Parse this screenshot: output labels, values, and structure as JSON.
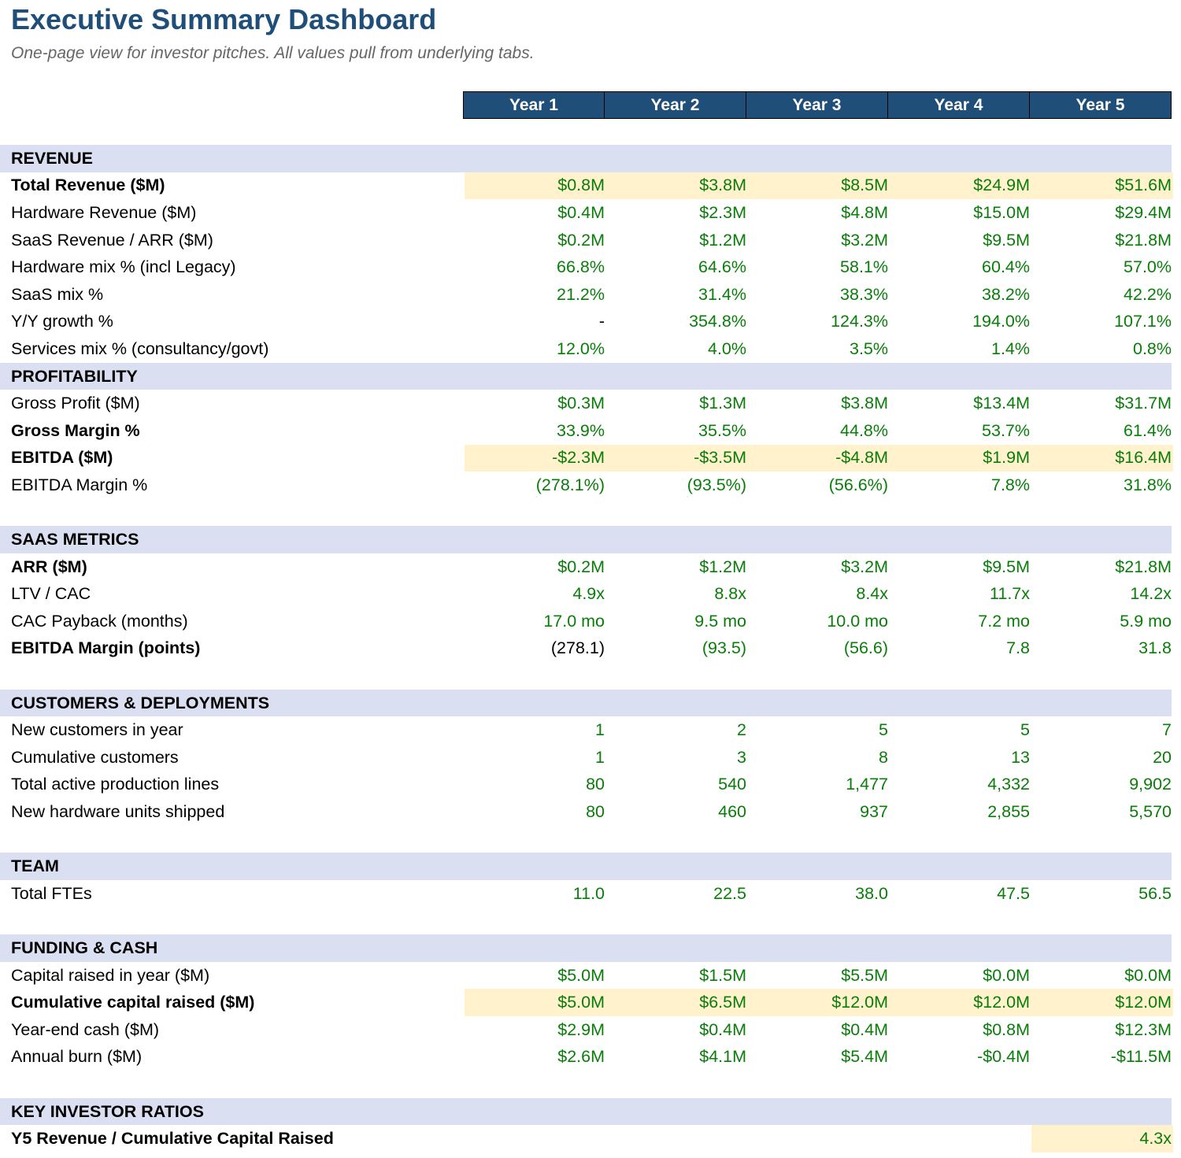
{
  "title": "Executive Summary Dashboard",
  "subtitle": "One-page view for investor pitches. All values pull from underlying tabs.",
  "years": [
    "Year 1",
    "Year 2",
    "Year 3",
    "Year 4",
    "Year 5"
  ],
  "colors": {
    "header_bg": "#1f4e79",
    "section_bg": "#dae0f2",
    "highlight_bg": "#fff2cc",
    "value_green": "#0a7d0a"
  },
  "rows": [
    {
      "type": "section",
      "label": "REVENUE"
    },
    {
      "type": "data",
      "label": "Total Revenue ($M)",
      "bold": true,
      "highlight": true,
      "values": [
        "$0.8M",
        "$3.8M",
        "$8.5M",
        "$24.9M",
        "$51.6M"
      ]
    },
    {
      "type": "data",
      "label": "Hardware Revenue ($M)",
      "values": [
        "$0.4M",
        "$2.3M",
        "$4.8M",
        "$15.0M",
        "$29.4M"
      ]
    },
    {
      "type": "data",
      "label": "SaaS Revenue / ARR ($M)",
      "values": [
        "$0.2M",
        "$1.2M",
        "$3.2M",
        "$9.5M",
        "$21.8M"
      ]
    },
    {
      "type": "data",
      "label": "Hardware mix % (incl Legacy)",
      "values": [
        "66.8%",
        "64.6%",
        "58.1%",
        "60.4%",
        "57.0%"
      ]
    },
    {
      "type": "data",
      "label": "SaaS mix %",
      "values": [
        "21.2%",
        "31.4%",
        "38.3%",
        "38.2%",
        "42.2%"
      ]
    },
    {
      "type": "data",
      "label": "Y/Y growth %",
      "values": [
        "-",
        "354.8%",
        "124.3%",
        "194.0%",
        "107.1%"
      ],
      "first_black": true
    },
    {
      "type": "data",
      "label": "Services mix % (consultancy/govt)",
      "values": [
        "12.0%",
        "4.0%",
        "3.5%",
        "1.4%",
        "0.8%"
      ]
    },
    {
      "type": "section",
      "label": "PROFITABILITY"
    },
    {
      "type": "data",
      "label": "Gross Profit ($M)",
      "values": [
        "$0.3M",
        "$1.3M",
        "$3.8M",
        "$13.4M",
        "$31.7M"
      ]
    },
    {
      "type": "data",
      "label": "Gross Margin %",
      "bold": true,
      "values": [
        "33.9%",
        "35.5%",
        "44.8%",
        "53.7%",
        "61.4%"
      ]
    },
    {
      "type": "data",
      "label": "EBITDA ($M)",
      "bold": true,
      "highlight": true,
      "values": [
        "-$2.3M",
        "-$3.5M",
        "-$4.8M",
        "$1.9M",
        "$16.4M"
      ]
    },
    {
      "type": "data",
      "label": "EBITDA Margin %",
      "values": [
        "(278.1%)",
        "(93.5%)",
        "(56.6%)",
        "7.8%",
        "31.8%"
      ]
    },
    {
      "type": "spacer"
    },
    {
      "type": "section",
      "label": "SAAS METRICS"
    },
    {
      "type": "data",
      "label": "ARR ($M)",
      "bold": true,
      "values": [
        "$0.2M",
        "$1.2M",
        "$3.2M",
        "$9.5M",
        "$21.8M"
      ]
    },
    {
      "type": "data",
      "label": "LTV / CAC",
      "values": [
        "4.9x",
        "8.8x",
        "8.4x",
        "11.7x",
        "14.2x"
      ]
    },
    {
      "type": "data",
      "label": "CAC Payback (months)",
      "values": [
        "17.0 mo",
        "9.5 mo",
        "10.0 mo",
        "7.2 mo",
        "5.9 mo"
      ]
    },
    {
      "type": "data",
      "label": "EBITDA Margin (points)",
      "bold": true,
      "values": [
        "(278.1)",
        "(93.5)",
        "(56.6)",
        "7.8",
        "31.8"
      ],
      "first_black": true
    },
    {
      "type": "spacer"
    },
    {
      "type": "section",
      "label": "CUSTOMERS & DEPLOYMENTS"
    },
    {
      "type": "data",
      "label": "New customers in year",
      "values": [
        "1",
        "2",
        "5",
        "5",
        "7"
      ]
    },
    {
      "type": "data",
      "label": "Cumulative customers",
      "values": [
        "1",
        "3",
        "8",
        "13",
        "20"
      ]
    },
    {
      "type": "data",
      "label": "Total active production lines",
      "values": [
        "80",
        "540",
        "1,477",
        "4,332",
        "9,902"
      ]
    },
    {
      "type": "data",
      "label": "New hardware units shipped",
      "values": [
        "80",
        "460",
        "937",
        "2,855",
        "5,570"
      ]
    },
    {
      "type": "spacer"
    },
    {
      "type": "section",
      "label": "TEAM"
    },
    {
      "type": "data",
      "label": "Total FTEs",
      "values": [
        "11.0",
        "22.5",
        "38.0",
        "47.5",
        "56.5"
      ]
    },
    {
      "type": "spacer"
    },
    {
      "type": "section",
      "label": "FUNDING & CASH"
    },
    {
      "type": "data",
      "label": "Capital raised in year ($M)",
      "values": [
        "$5.0M",
        "$1.5M",
        "$5.5M",
        "$0.0M",
        "$0.0M"
      ]
    },
    {
      "type": "data",
      "label": "Cumulative capital raised ($M)",
      "bold": true,
      "highlight": true,
      "values": [
        "$5.0M",
        "$6.5M",
        "$12.0M",
        "$12.0M",
        "$12.0M"
      ]
    },
    {
      "type": "data",
      "label": "Year-end cash ($M)",
      "values": [
        "$2.9M",
        "$0.4M",
        "$0.4M",
        "$0.8M",
        "$12.3M"
      ]
    },
    {
      "type": "data",
      "label": "Annual burn ($M)",
      "values": [
        "$2.6M",
        "$4.1M",
        "$5.4M",
        "-$0.4M",
        "-$11.5M"
      ]
    },
    {
      "type": "spacer"
    },
    {
      "type": "section",
      "label": "KEY INVESTOR RATIOS"
    },
    {
      "type": "data",
      "label": "Y5 Revenue / Cumulative Capital Raised",
      "bold": true,
      "values": [
        "",
        "",
        "",
        "",
        "4.3x"
      ],
      "last_highlight": true
    }
  ]
}
